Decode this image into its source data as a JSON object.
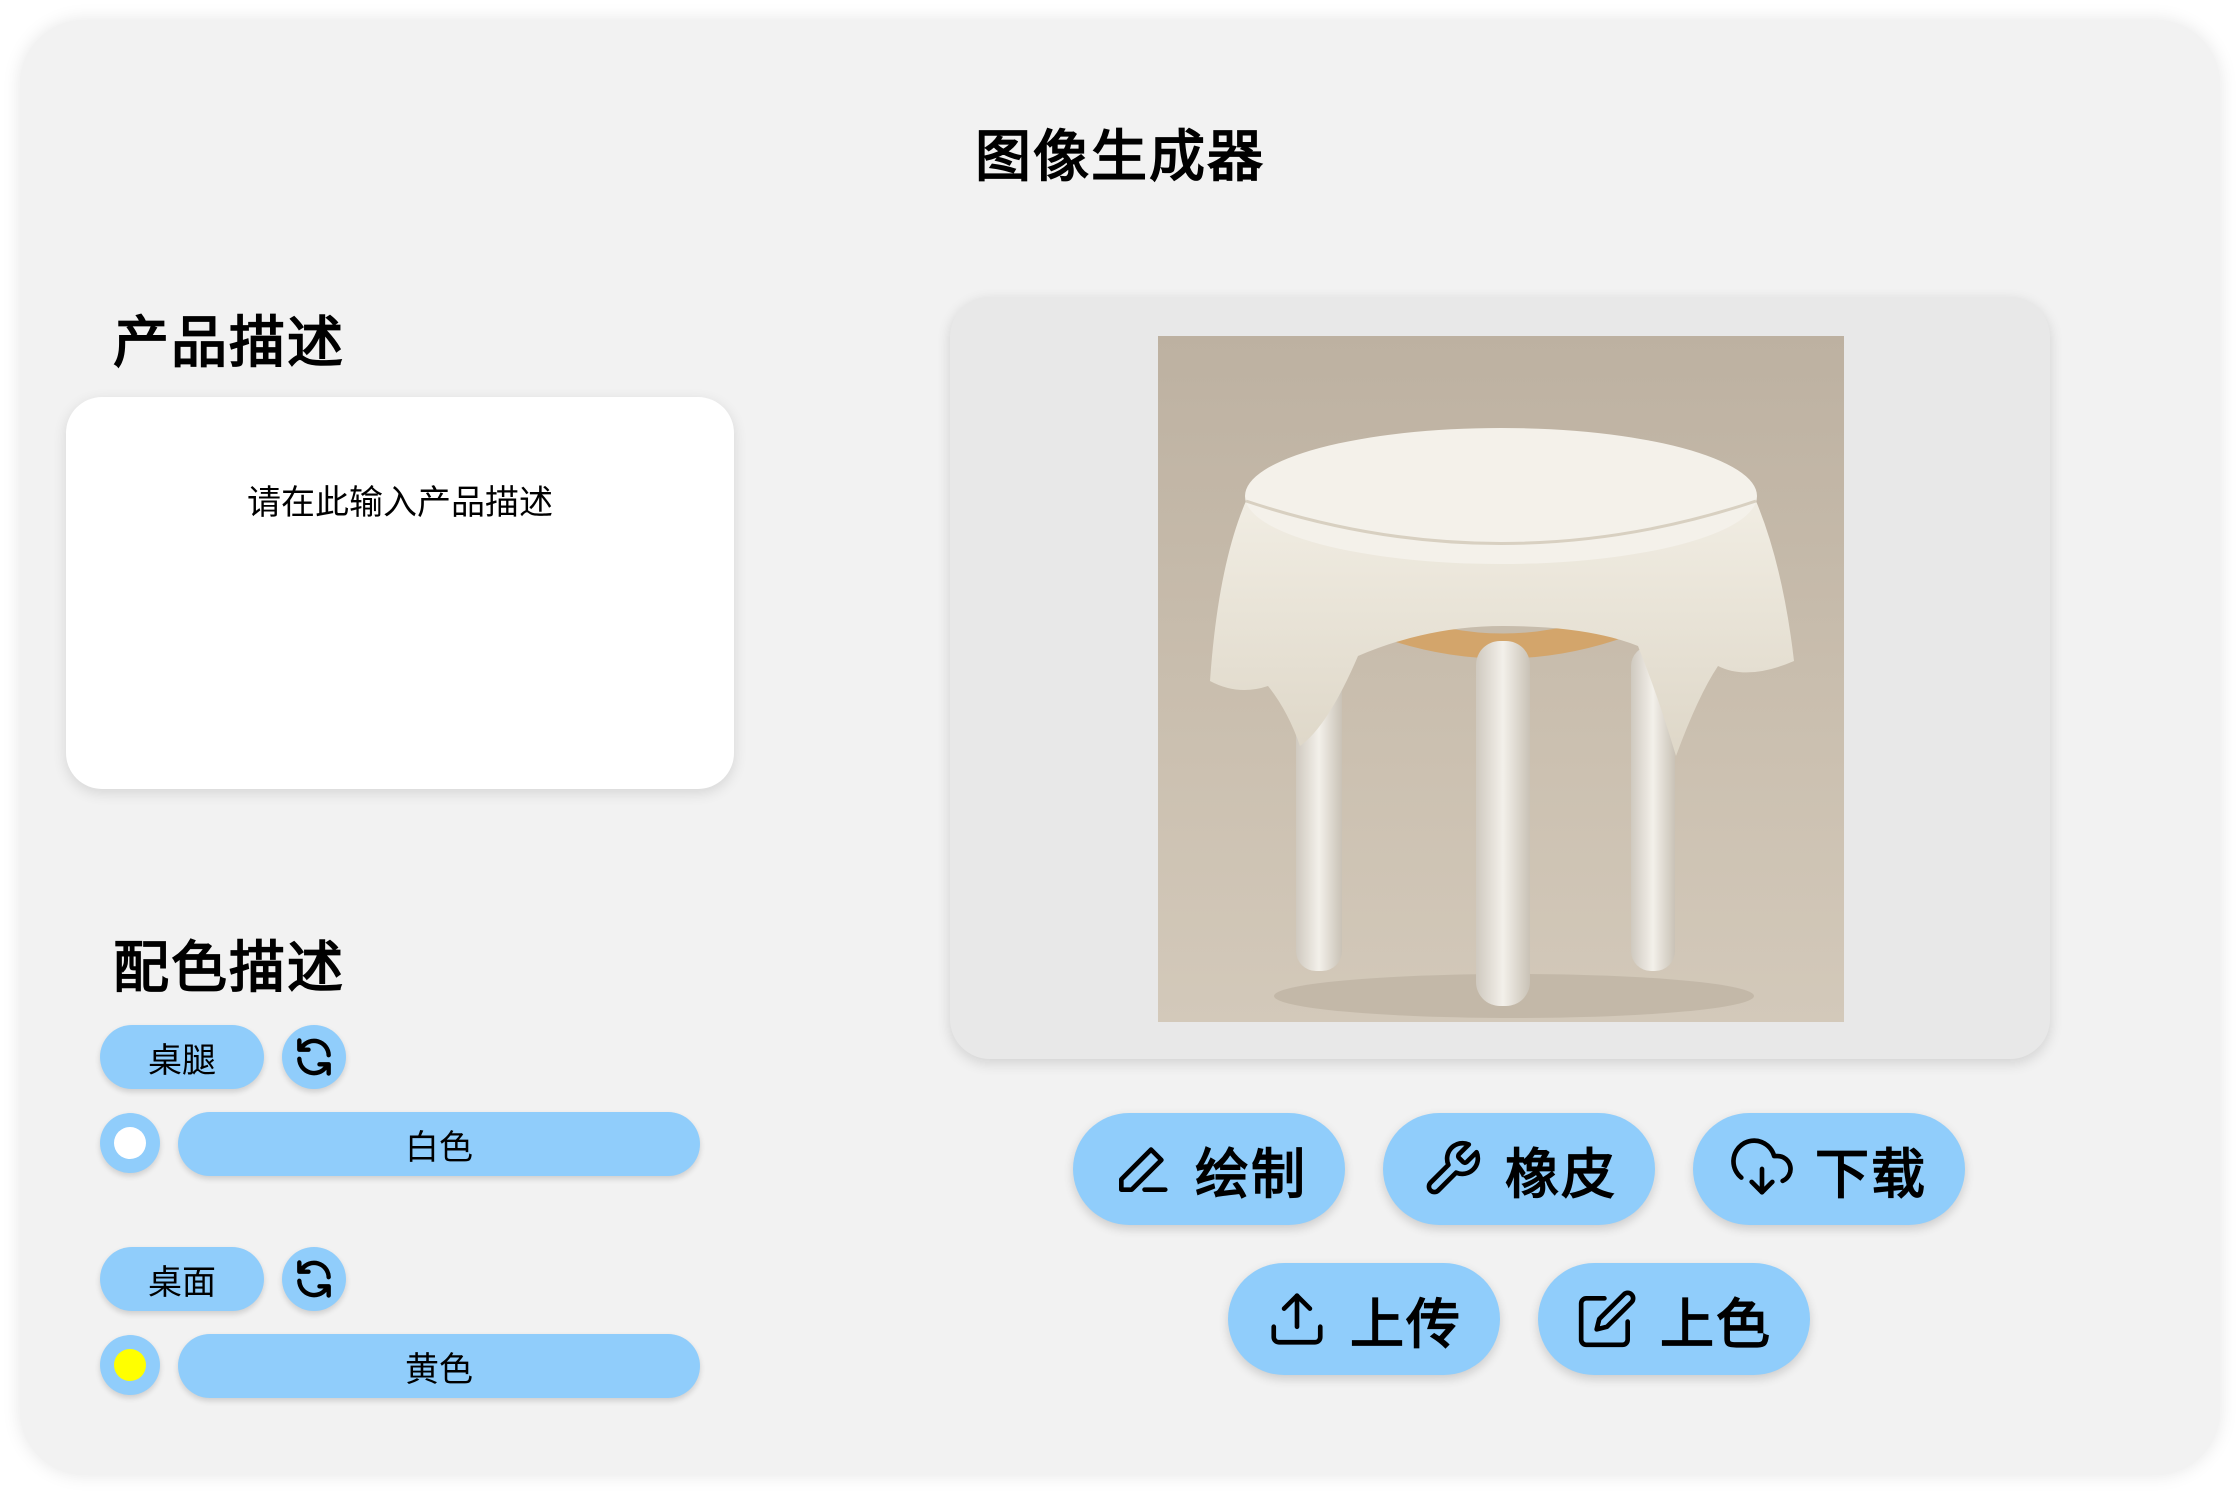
{
  "app": {
    "title": "图像生成器"
  },
  "product": {
    "heading": "产品描述",
    "placeholder": "请在此输入产品描述",
    "value": ""
  },
  "colors": {
    "heading": "配色描述",
    "items": [
      {
        "part": "桌腿",
        "color_name": "白色",
        "swatch": "#ffffff",
        "refresh_icon": "refresh-icon"
      },
      {
        "part": "桌面",
        "color_name": "黄色",
        "swatch": "#ffff00",
        "refresh_icon": "refresh-icon"
      }
    ]
  },
  "preview": {
    "image_icon": "product-image"
  },
  "actions": {
    "draw": {
      "label": "绘制",
      "icon": "pen-icon"
    },
    "eraser": {
      "label": "橡皮",
      "icon": "wrench-icon"
    },
    "download": {
      "label": "下载",
      "icon": "cloud-download-icon"
    },
    "upload": {
      "label": "上传",
      "icon": "upload-icon"
    },
    "colorize": {
      "label": "上色",
      "icon": "edit-icon"
    }
  },
  "theme": {
    "accent": "#90cdfb",
    "panel": "#f2f2f2",
    "preview_bg": "#e8e8e8"
  }
}
